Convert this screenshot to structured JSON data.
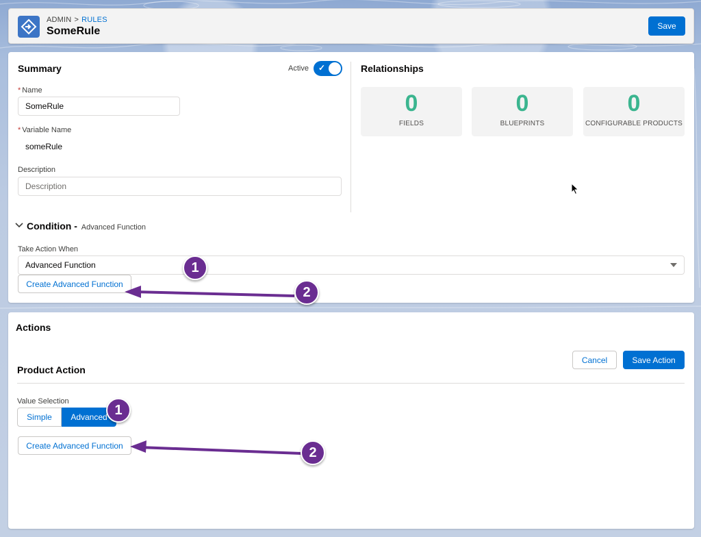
{
  "header": {
    "breadcrumb_root": "ADMIN",
    "breadcrumb_sep": ">",
    "breadcrumb_link": "RULES",
    "title": "SomeRule",
    "save_label": "Save"
  },
  "summary": {
    "heading": "Summary",
    "active_label": "Active",
    "active": true,
    "name_required": "*",
    "name_label": "Name",
    "name_value": "SomeRule",
    "varname_required": "*",
    "varname_label": "Variable Name",
    "varname_value": "someRule",
    "description_label": "Description",
    "description_placeholder": "Description"
  },
  "relationships": {
    "heading": "Relationships",
    "stats": [
      {
        "value": "0",
        "label": "FIELDS"
      },
      {
        "value": "0",
        "label": "BLUEPRINTS"
      },
      {
        "value": "0",
        "label": "CONFIGURABLE PRODUCTS"
      }
    ]
  },
  "condition": {
    "title": "Condition -",
    "subtitle": "Advanced Function",
    "take_action_label": "Take Action When",
    "selected": "Advanced Function",
    "create_button": "Create Advanced Function"
  },
  "actions": {
    "heading": "Actions",
    "product_action": "Product Action",
    "cancel_label": "Cancel",
    "save_action_label": "Save Action",
    "value_selection_label": "Value Selection",
    "segments": [
      "Simple",
      "Advanced"
    ],
    "selected_segment": "Advanced",
    "create_button": "Create Advanced Function"
  },
  "annotations": {
    "badge_1": "1",
    "badge_2": "2",
    "color": "#6a2d91"
  },
  "colors": {
    "brand": "#0070d2",
    "stat_number": "#3bb58f",
    "header_bg": "#f3f3f3"
  }
}
